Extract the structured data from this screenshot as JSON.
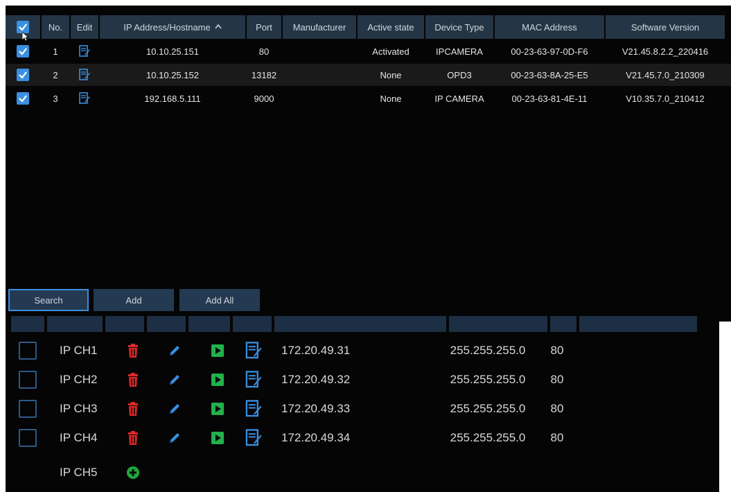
{
  "search_panel": {
    "columns": [
      "No.",
      "Edit",
      "IP Address/Hostname",
      "Port",
      "Manufacturer",
      "Active state",
      "Device Type",
      "MAC Address",
      "Software Version"
    ],
    "sort_arrow": "^",
    "rows": [
      {
        "no": "1",
        "ip": "10.10.25.151",
        "port": "80",
        "manufacturer": "",
        "active_state": "Activated",
        "device_type": "IPCAMERA",
        "mac": "00-23-63-97-0D-F6",
        "software": "V21.45.8.2.2_220416"
      },
      {
        "no": "2",
        "ip": "10.10.25.152",
        "port": "13182",
        "manufacturer": "",
        "active_state": "None",
        "device_type": "OPD3",
        "mac": "00-23-63-8A-25-E5",
        "software": "V21.45.7.0_210309"
      },
      {
        "no": "3",
        "ip": "192.168.5.111",
        "port": "9000",
        "manufacturer": "",
        "active_state": "None",
        "device_type": "IP CAMERA",
        "mac": "00-23-63-81-4E-11",
        "software": "V10.35.7.0_210412"
      }
    ],
    "buttons": {
      "search": "Search",
      "add": "Add",
      "add_all": "Add All"
    }
  },
  "added_panel": {
    "rows": [
      {
        "channel": "IP CH1",
        "ip": "172.20.49.31",
        "mask": "255.255.255.0",
        "port": "80"
      },
      {
        "channel": "IP CH2",
        "ip": "172.20.49.32",
        "mask": "255.255.255.0",
        "port": "80"
      },
      {
        "channel": "IP CH3",
        "ip": "172.20.49.33",
        "mask": "255.255.255.0",
        "port": "80"
      },
      {
        "channel": "IP CH4",
        "ip": "172.20.49.34",
        "mask": "255.255.255.0",
        "port": "80"
      }
    ],
    "empty_row": {
      "channel": "IP CH5"
    }
  },
  "icons": {
    "checkbox": "checkbox-checked-icon",
    "edit": "edit-document-icon",
    "delete": "trash-icon",
    "pencil": "pencil-icon",
    "play": "play-icon",
    "add": "plus-circle-icon"
  },
  "colors": {
    "accent": "#3a8fe0",
    "header_bg": "#243645",
    "delete_red": "#e02828",
    "play_green": "#22b14c",
    "add_green": "#1fa83a"
  }
}
